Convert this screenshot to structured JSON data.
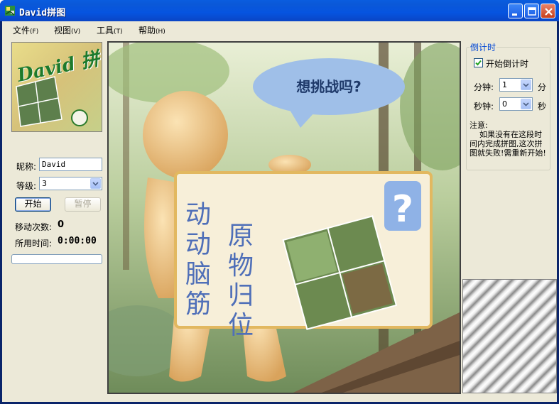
{
  "window": {
    "title": "David拼图"
  },
  "menu": [
    {
      "label": "文件",
      "accel": "(F)"
    },
    {
      "label": "视图",
      "accel": "(V)"
    },
    {
      "label": "工具",
      "accel": "(T)"
    },
    {
      "label": "帮助",
      "accel": "(H)"
    }
  ],
  "left": {
    "logo_text": "David 拼",
    "nickname_label": "昵称:",
    "nickname_value": "David",
    "level_label": "等级:",
    "level_value": "3",
    "start_button": "开始",
    "pause_button": "暂停",
    "moves_label": "移动次数:",
    "moves_value": "0",
    "time_label": "所用时间:",
    "time_value": "0:00:00",
    "progress": 0
  },
  "board": {
    "bubble_text": "想挑战吗?",
    "sign_col1": "动动脑筋",
    "sign_col2": "原物归位",
    "sign_mark": "?"
  },
  "countdown": {
    "group_title": "倒计时",
    "enable_label": "开始倒计时",
    "enabled": true,
    "minutes_label": "分钟:",
    "minutes_value": "1",
    "minutes_unit": "分",
    "seconds_label": "秒钟:",
    "seconds_value": "0",
    "seconds_unit": "秒",
    "note_title": "注意:",
    "note_body": "如果没有在这段时间内完成拼图,这次拼图就失败!需重新开始!"
  },
  "colors": {
    "titlebar": "#0a58d8",
    "window_bg": "#ece9d8",
    "accent_blue": "#0046d5"
  }
}
